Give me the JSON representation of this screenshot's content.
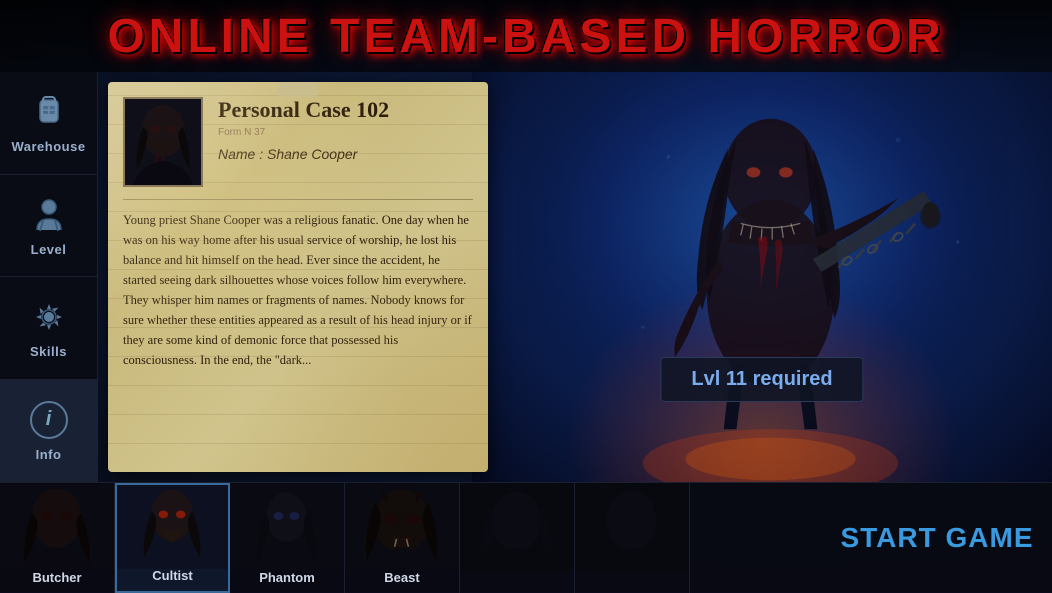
{
  "title": "ONLINE TEAM-BASED HORROR",
  "sidebar": {
    "items": [
      {
        "id": "warehouse",
        "label": "Warehouse",
        "icon": "backpack"
      },
      {
        "id": "level",
        "label": "Level",
        "icon": "person"
      },
      {
        "id": "skills",
        "label": "Skills",
        "icon": "gear"
      },
      {
        "id": "info",
        "label": "Info",
        "icon": "info",
        "active": true
      }
    ]
  },
  "card": {
    "title": "Personal Case 102",
    "form_number": "Form N 37",
    "name_label": "Name : Shane Cooper",
    "body": "Young priest Shane Cooper was a religious fanatic. One day when he was on his way home after his usual service of worship, he lost his balance and hit himself on the head. Ever since the accident, he started seeing dark silhouettes whose voices follow him everywhere. They whisper him names or fragments of names. Nobody knows for sure whether these entities appeared as a result of his head injury or if they are some kind of demonic force that possessed his consciousness. In the end, the \"dark..."
  },
  "monster": {
    "level_required": "Lvl 11 required"
  },
  "characters": [
    {
      "id": "butcher",
      "name": "Butcher",
      "selected": false
    },
    {
      "id": "cultist",
      "name": "Cultist",
      "selected": true
    },
    {
      "id": "phantom",
      "name": "Phantom",
      "selected": false
    },
    {
      "id": "beast",
      "name": "Beast",
      "selected": false
    },
    {
      "id": "slot5",
      "name": "",
      "selected": false
    },
    {
      "id": "slot6",
      "name": "",
      "selected": false
    }
  ],
  "start_button": "START GAME",
  "colors": {
    "title_red": "#cc1111",
    "sidebar_bg": "#0a0c14",
    "accent_blue": "#3a9adf",
    "card_bg": "#c8b87a",
    "monster_badge_text": "#7aaced"
  }
}
